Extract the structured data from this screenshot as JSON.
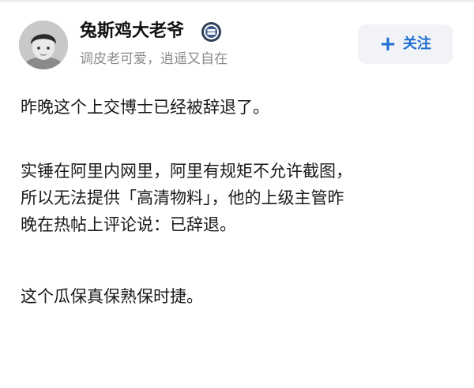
{
  "user": {
    "name": "兔斯鸡大老爷",
    "bio": "调皮老可爱，逍遥又自在",
    "badge_icon": "verified-badge-icon"
  },
  "follow_button": {
    "icon": "plus-icon",
    "plus": "+",
    "label": "关注",
    "color": "#1f6ed4"
  },
  "post": {
    "paragraphs": [
      [
        "昨晚这个上交博士已经被辞退了。"
      ],
      [
        "实锤在阿里内网里，阿里有规矩不允许截图，",
        "所以无法提供「高清物料」，他的上级主管昨",
        "晚在热帖上评论说：已辞退。"
      ],
      [
        "这个瓜保真保熟保时捷。"
      ]
    ]
  }
}
